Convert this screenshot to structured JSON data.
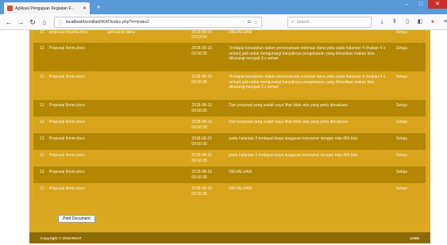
{
  "browser": {
    "tab_title": "Aplikasi Pengajuan Kegiatan F...",
    "url_prefix": "localhost/",
    "url_rest": "bismillahRKAT/index.php?m=index2",
    "search_placeholder": "Search",
    "colors": {
      "tabbar": "#5a9ad8",
      "close": "#c9302c"
    }
  },
  "table": {
    "rows": [
      {
        "no": "13",
        "file": "proposal mouma.docx",
        "ket": "pencairan dana",
        "time": "2018-08-15 03:53:54",
        "msg": "DIEVALUASI",
        "status": "Setuju"
      },
      {
        "no": "13",
        "file": "Proposal Ikmm.docx",
        "ket": "",
        "time": "2018-08-15 09:50:35",
        "msg": "Terdapat kesalahan dalam perencanaan estimasi dana yaitu pada halaman 4 (makan 4 x sehari) jadi untuk mengurangi banyaknya pengeluaran yang dihasilkan makan bisa dikurangi menjadi 3 x sehari",
        "status": "Setuju"
      },
      {
        "no": "13",
        "file": "Proposal Ikmm.docx",
        "ket": "",
        "time": "2018-08-15 09:50:35",
        "msg": "Terdapat kesalahan dalam perencanaan estimasi dana yaitu pada halaman 4 (makan 4 x sehari) jadi untuk mengurangi banyaknya pengeluaran yang dihasilkan makan bisa dikurangi menjadi 3 x sehari",
        "status": "Setuju"
      },
      {
        "no": "13",
        "file": "Proposal Ikmm.docx",
        "ket": "",
        "time": "2018-08-15 09:50:35",
        "msg": "Dari proposal yang sudah saya lihat tidak ada yang perlu dievaluasi",
        "status": "Setuju"
      },
      {
        "no": "13",
        "file": "Proposal Ikmm.docx",
        "ket": "",
        "time": "2018-08-15 09:50:35",
        "msg": "Dari proposal yang sudah saya lihat tidak ada yang perlu dievaluasi",
        "status": "Setuju"
      },
      {
        "no": "13",
        "file": "Proposal Ikmm.docx",
        "ket": "",
        "time": "2018-08-15 09:50:35",
        "msg": "pada halaman 3 terdapat biaya anggaran konsumsi dengan nilai 450 biss",
        "status": "Setuju"
      },
      {
        "no": "13",
        "file": "Proposal Ikmm.docx",
        "ket": "",
        "time": "2018-08-15 09:50:35",
        "msg": "pada halaman 3 terdapat biaya anggaran konsumsi dengan nilai 450 biss",
        "status": "Setuju"
      },
      {
        "no": "13",
        "file": "Proposal Ikmm.docx",
        "ket": "",
        "time": "2018-08-15 09:50:35",
        "msg": "DIEVALUASI",
        "status": "Setuju"
      },
      {
        "no": "13",
        "file": "Proposal Ikmm.docx",
        "ket": "",
        "time": "2018-08-15 09:50:35",
        "msg": "DIEVALUASI",
        "status": "Setuju"
      }
    ]
  },
  "print_button_label": "Print Document",
  "footer": {
    "copyright": "Copyright © 2018 RKAT",
    "right": "UNIM"
  },
  "colors": {
    "panel": "#dca923",
    "row_dark": "#b38702",
    "footer": "#8c6a06"
  }
}
